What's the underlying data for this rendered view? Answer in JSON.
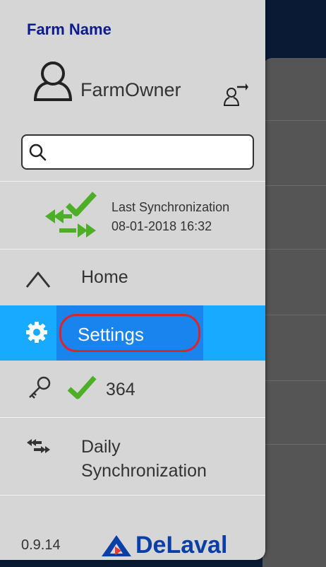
{
  "drawer": {
    "farm_name": "Farm Name",
    "user": {
      "name": "FarmOwner"
    },
    "search": {
      "value": "",
      "placeholder": ""
    },
    "sync": {
      "title": "Last Synchronization",
      "time": "08-01-2018 16:32"
    },
    "menu": {
      "home": "Home",
      "settings": "Settings",
      "license_count": "364",
      "daily_line1": "Daily",
      "daily_line2": "Synchronization"
    },
    "footer": {
      "version": "0.9.14",
      "brand": "DeLaval"
    }
  },
  "colors": {
    "accent": "#17aaff",
    "accent_dark": "#1a84ee",
    "highlight_ring": "#d8262c",
    "farm_name": "#0a1c8f",
    "sync_green": "#4caf25",
    "brand_blue": "#0a3fa8"
  },
  "icons": [
    "user-icon",
    "switch-user-icon",
    "search-icon",
    "sync-arrows-icon",
    "check-icon",
    "home-icon",
    "gear-icon",
    "key-icon",
    "daily-sync-icon",
    "delaval-logo"
  ]
}
